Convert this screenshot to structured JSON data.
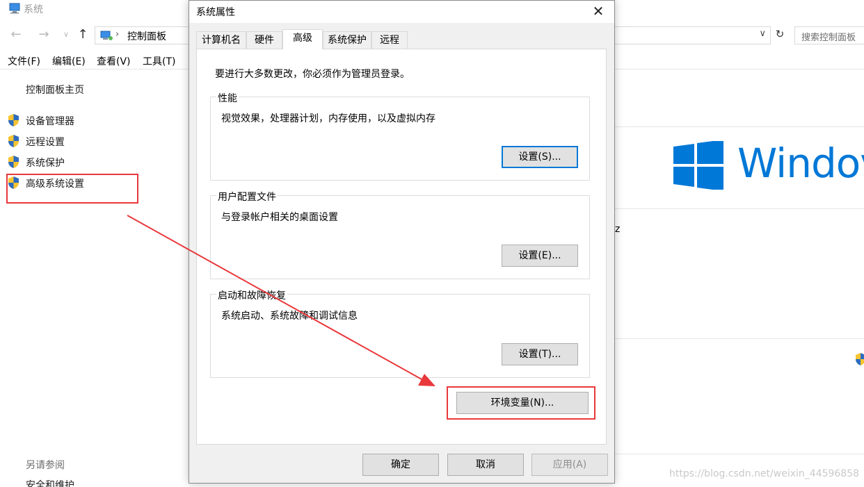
{
  "window": {
    "title": "系统",
    "breadcrumb": "控制面板",
    "breadcrumb_sep": "›",
    "search_placeholder": "搜索控制面板"
  },
  "menubar": {
    "file": "文件(F)",
    "edit": "编辑(E)",
    "view": "查看(V)",
    "tools": "工具(T)"
  },
  "sidebar": {
    "home": "控制面板主页",
    "items": [
      {
        "label": "设备管理器"
      },
      {
        "label": "远程设置"
      },
      {
        "label": "系统保护"
      },
      {
        "label": "高级系统设置"
      }
    ],
    "also_see": "另请参阅",
    "security": "安全和维护"
  },
  "right_panel": {
    "windows_text": "Windov",
    "fragment": "z"
  },
  "dialog": {
    "title": "系统属性",
    "close": "✕",
    "tabs": [
      {
        "label": "计算机名"
      },
      {
        "label": "硬件"
      },
      {
        "label": "高级"
      },
      {
        "label": "系统保护"
      },
      {
        "label": "远程"
      }
    ],
    "active_tab": "高级",
    "admin_note": "要进行大多数更改，你必须作为管理员登录。",
    "performance": {
      "title": "性能",
      "desc": "视觉效果，处理器计划，内存使用，以及虚拟内存",
      "button": "设置(S)..."
    },
    "user_profiles": {
      "title": "用户配置文件",
      "desc": "与登录帐户相关的桌面设置",
      "button": "设置(E)..."
    },
    "startup_recovery": {
      "title": "启动和故障恢复",
      "desc": "系统启动、系统故障和调试信息",
      "button": "设置(T)..."
    },
    "env_button": "环境变量(N)...",
    "ok": "确定",
    "cancel": "取消",
    "apply": "应用(A)"
  },
  "watermark": "https://blog.csdn.net/weixin_44596858",
  "colors": {
    "accent": "#0078d7",
    "annotation": "#e8383c"
  }
}
